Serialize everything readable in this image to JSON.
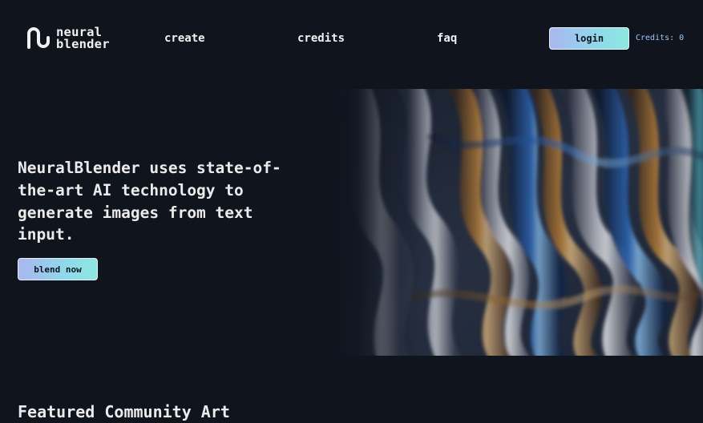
{
  "header": {
    "logo": {
      "icon": "neural-blender-logo-icon",
      "line1": "neural",
      "line2": "blender"
    },
    "nav": [
      {
        "label": "create"
      },
      {
        "label": "credits"
      },
      {
        "label": "faq"
      }
    ],
    "login_label": "login",
    "credits_readout": "Credits: 0"
  },
  "hero": {
    "headline": "NeuralBlender uses state-of-the-art AI technology to generate images from text input.",
    "cta_label": "blend now",
    "art": "abstract-iridescent-fluid-image"
  },
  "featured": {
    "title": "Featured Community Art"
  },
  "colors": {
    "background": "#0f141d",
    "button_gradient_start": "#aab6f0",
    "button_gradient_end": "#8de8e0",
    "credits_text": "#9fc6f5"
  }
}
